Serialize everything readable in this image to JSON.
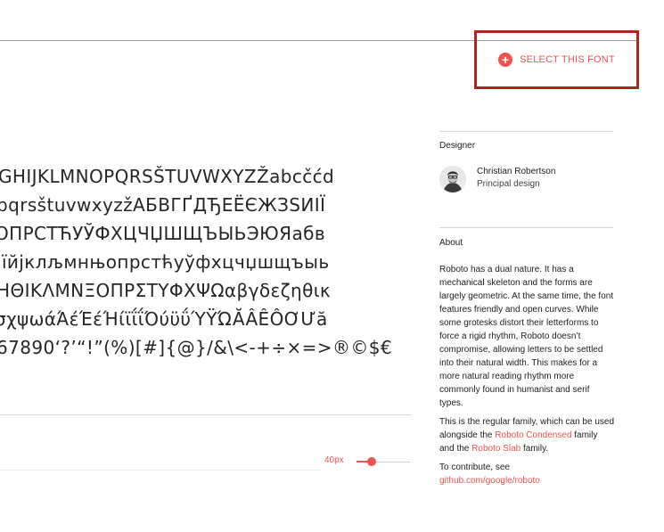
{
  "header": {
    "select_label": "SELECT THIS FONT",
    "select_icon": "plus-circle-icon"
  },
  "specimen": {
    "lines": [
      "GHIJKLMNOPQRSŠTUVWXYZŽabcčćd",
      "pqrsštuvwxyzžАБВГҐДЂЕЁЄЖЗЅИІЇ",
      "ОПРСТЋУЎФХЦЧЏШЩЪЫЬЭЮЯабв",
      "іїйјклљмнњопрстћуўфхцчџшщъыь",
      "ΗΘΙΚΛΜΝΞΟΠΡΣΤΥΦΧΨΩαβγδεζηθικ",
      "σχψωάΆέΈέΉίϊΐΐΌύϋΰΎΫΏĂÂÊÔƠƯă",
      "67890‘?’“!”(%)[#]{@}/&\\<-+÷×=>®©$€"
    ]
  },
  "controls": {
    "size_label": "40px",
    "size_value": 40
  },
  "designer": {
    "section_title": "Designer",
    "name": "Christian Robertson",
    "role": "Principal design"
  },
  "about": {
    "section_title": "About",
    "paragraph1": "Roboto has a dual nature. It has a mechanical skeleton and the forms are largely geometric. At the same time, the font features friendly and open curves. While some grotesks distort their letterforms to force a rigid rhythm, Roboto doesn’t compromise, allowing letters to be settled into their natural width. This makes for a more natural reading rhythm more commonly found in humanist and serif types.",
    "p2_before": "This is the regular family, which can be used alongside the ",
    "p2_link1": "Roboto Condensed",
    "p2_middle": " family and the ",
    "p2_link2": "Roboto Slab",
    "p2_after": " family.",
    "p3_text": "To contribute, see",
    "p3_link": "github.com/google/roboto"
  },
  "colors": {
    "accent": "#ef5350",
    "highlight_border": "#a52a1e"
  }
}
